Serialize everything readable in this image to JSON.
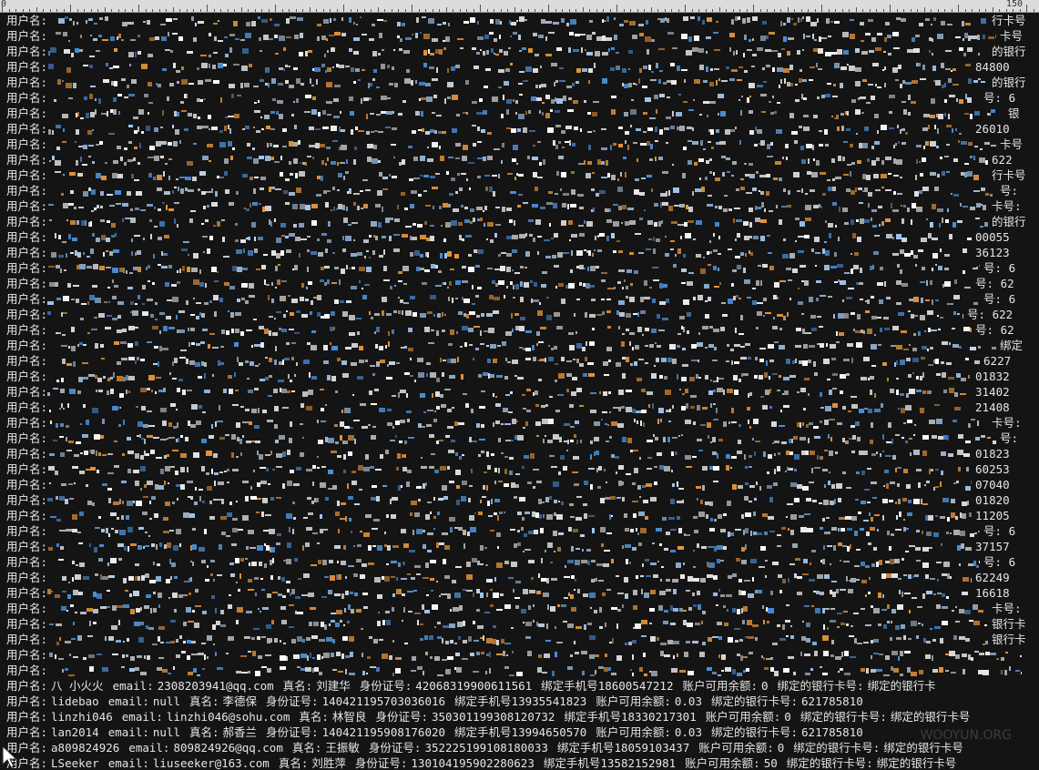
{
  "ruler": {
    "start_label": "0",
    "end_label": "150"
  },
  "row_label": "用户名:",
  "obscured_row_count": 43,
  "tail_fragments": [
    "行卡号",
    "卡号",
    "的银行",
    "84800",
    "的银行",
    "号: 6",
    "银",
    "26010",
    "卡号",
    "622",
    "行卡号",
    "号:",
    "卡号:",
    "的银行",
    "00055",
    "36123",
    "号: 6",
    "号: 62",
    "号: 6",
    "号: 622",
    "号: 62",
    "绑定",
    "6227",
    "01832",
    "31402",
    "21408",
    "卡号:",
    "号:",
    "01823",
    "60253",
    "07040",
    "01820",
    "11205",
    "号: 6",
    "37157",
    "号: 6",
    "62249",
    "16618",
    "卡号:",
    "银行卡",
    "银行卡",
    "",
    ""
  ],
  "clear_rows": [
    {
      "username": "八 小火火",
      "email": "2308203941@qq.com",
      "realname": "刘建华",
      "id_number": "42068319900611561",
      "phone": "18600547212",
      "balance": "0",
      "card": "绑定的银行卡"
    },
    {
      "username": "lidebao",
      "email": "null",
      "realname": "李德保",
      "id_number": "140421195703036016",
      "phone": "13935541823",
      "balance": "0.03",
      "card": "621785810"
    },
    {
      "username": "linzhi046",
      "email": "linzhi046@sohu.com",
      "realname": "林智良",
      "id_number": "350301199308120732",
      "phone": "18330217301",
      "balance": "0",
      "card": "绑定的银行卡号"
    },
    {
      "username": "lan2014",
      "email": "null",
      "realname": "郝香兰",
      "id_number": "140421195908176020",
      "phone": "13994650570",
      "balance": "0.03",
      "card": "621785810"
    },
    {
      "username": "a809824926",
      "email": "809824926@qq.com",
      "realname": "王振敏",
      "id_number": "352225199108180033",
      "phone": "18059103437",
      "balance": "0",
      "card": "绑定的银行卡号"
    },
    {
      "username": "LSeeker",
      "email": "liuseeker@163.com",
      "realname": "刘胜萍",
      "id_number": "130104195902280623",
      "phone": "13582152981",
      "balance": "50",
      "card": "绑定的银行卡号"
    }
  ],
  "field_labels": {
    "email": "email:",
    "realname": "真名:",
    "id_number": "身份证号:",
    "phone": "绑定手机号",
    "balance": "账户可用余额:",
    "card": "绑定的银行卡号:"
  },
  "watermark": "WOOYUN.ORG",
  "colors": {
    "background": "#141414",
    "text": "#e8e8e8",
    "noise_blue": "#4a8fd8",
    "noise_orange": "#e8953a",
    "noise_white": "#ffffff"
  }
}
